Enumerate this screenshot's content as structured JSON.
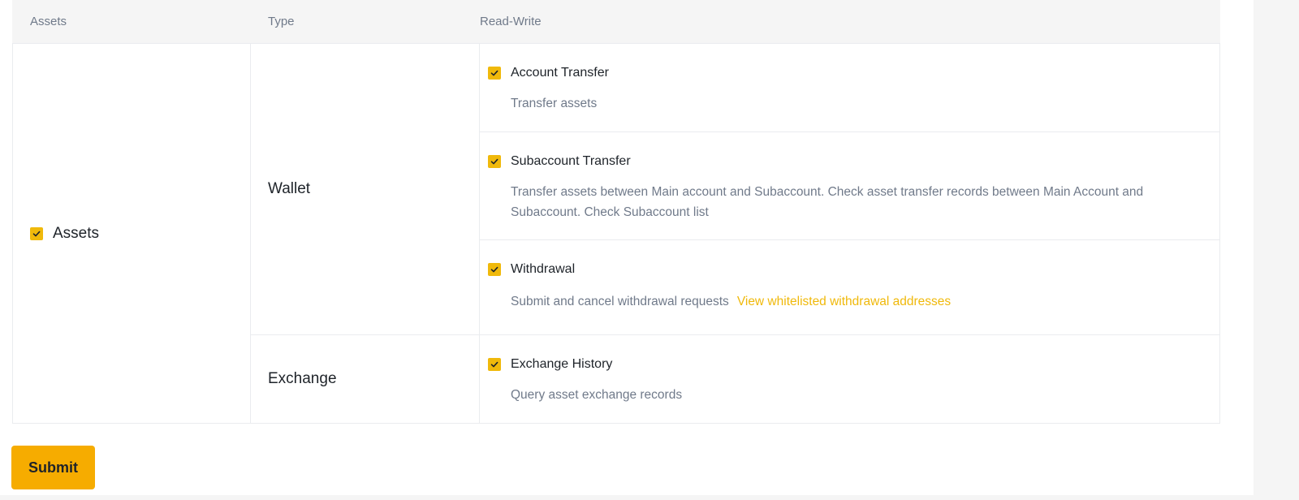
{
  "colors": {
    "accent": "#f0b90b",
    "button": "#f6ac00",
    "text_primary": "#1e2329",
    "text_secondary": "#707a8a",
    "border": "#eaecef",
    "header_bg": "#f5f5f5"
  },
  "table": {
    "headers": {
      "assets": "Assets",
      "type": "Type",
      "read_write": "Read-Write"
    },
    "asset_group": {
      "label": "Assets",
      "checked": true
    },
    "groups": [
      {
        "type": "Wallet",
        "permissions": [
          {
            "title": "Account Transfer",
            "description": "Transfer assets",
            "checked": true
          },
          {
            "title": "Subaccount Transfer",
            "description": "Transfer assets between Main account and Subaccount. Check asset transfer records between Main Account and Subaccount. Check Subaccount list",
            "checked": true
          },
          {
            "title": "Withdrawal",
            "description": "Submit and cancel withdrawal requests",
            "link": "View whitelisted withdrawal addresses",
            "checked": true
          }
        ]
      },
      {
        "type": "Exchange",
        "permissions": [
          {
            "title": "Exchange History",
            "description": "Query asset exchange records",
            "checked": true
          }
        ]
      }
    ]
  },
  "submit_label": "Submit"
}
